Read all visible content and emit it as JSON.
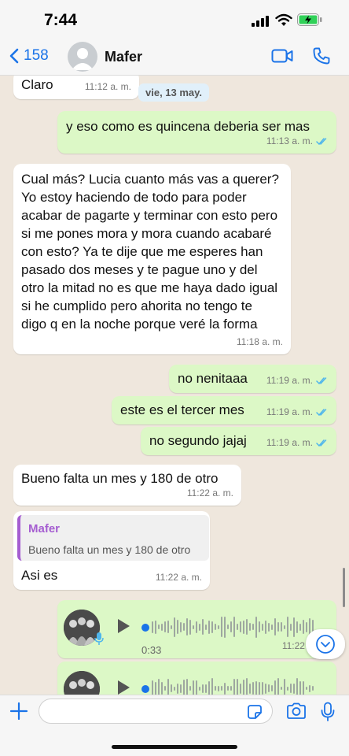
{
  "status": {
    "time": "7:44"
  },
  "header": {
    "back_count": "158",
    "contact_name": "Mafer"
  },
  "chat": {
    "date_chip": "vie, 13 may.",
    "messages": [
      {
        "dir": "in",
        "text": "Claro",
        "time": "11:12 a. m."
      },
      {
        "dir": "out",
        "text": "y eso como es quincena deberia ser mas",
        "time": "11:13 a. m."
      },
      {
        "dir": "in",
        "text": "Cual más?  Lucia cuanto más vas a querer? Yo estoy haciendo de todo para poder acabar de pagarte y terminar con esto pero si me pones mora y mora cuando acabaré con esto? Ya te dije que me esperes han pasado dos meses y te pague uno y del otro la mitad no es que me haya dado igual si he cumplido pero ahorita no tengo te digo q en la noche porque veré la forma",
        "time": "11:18 a. m."
      },
      {
        "dir": "out",
        "text": "no nenitaaa",
        "time": "11:19 a. m."
      },
      {
        "dir": "out",
        "text": "este es el tercer mes",
        "time": "11:19 a. m."
      },
      {
        "dir": "out",
        "text": "no segundo jajaj",
        "time": "11:19 a. m."
      },
      {
        "dir": "in",
        "text": "Bueno falta un mes y 180 de otro",
        "time": "11:22 a. m."
      },
      {
        "dir": "in",
        "quote_name": "Mafer",
        "quote_text": "Bueno falta un mes y 180 de otro",
        "text": "Asi es",
        "time": "11:22 a. m."
      },
      {
        "dir": "out",
        "type": "voice",
        "duration": "0:33",
        "time": "11:22 a. m."
      },
      {
        "dir": "out",
        "type": "voice",
        "duration": "",
        "time": ""
      }
    ]
  },
  "composer": {
    "value": "",
    "placeholder": ""
  },
  "icons": [
    "back-chevron-icon",
    "video-call-icon",
    "phone-icon",
    "plus-icon",
    "sticker-icon",
    "camera-icon",
    "mic-icon",
    "play-icon",
    "scroll-down-icon",
    "double-check-icon"
  ],
  "colors": {
    "accent": "#1a73e8",
    "outgoing_bubble": "#dcf8c6",
    "incoming_bubble": "#ffffff",
    "chat_bg": "#efe7dd",
    "quote_accent": "#a55dd1"
  }
}
